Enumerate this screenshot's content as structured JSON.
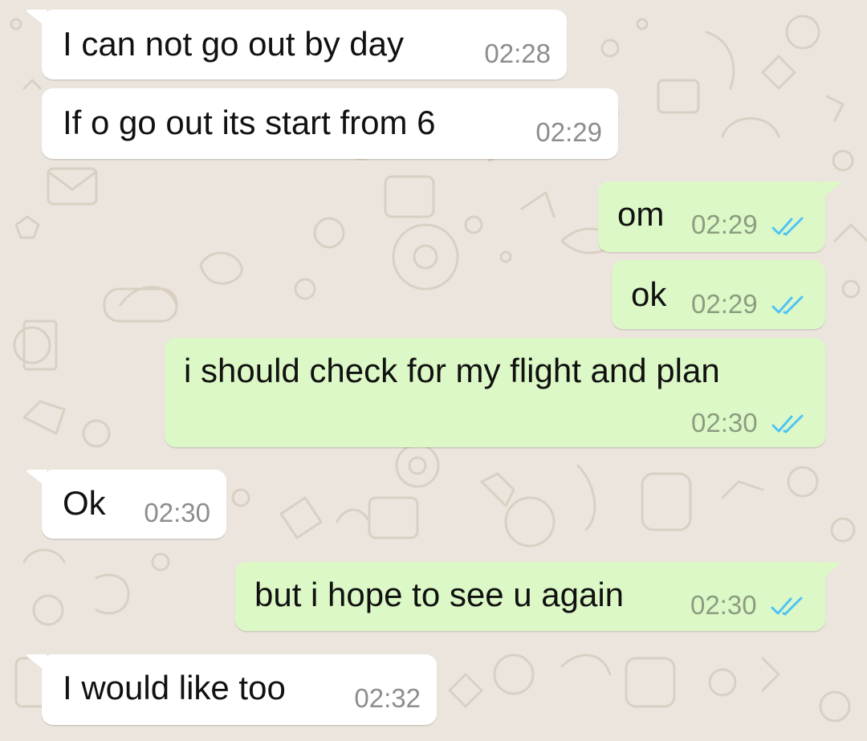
{
  "theme": {
    "incoming_bg": "#ffffff",
    "outgoing_bg": "#dcf8c6",
    "read_ticks_color": "#4fc3f7",
    "wallpaper_bg": "#ece5dd"
  },
  "messages": [
    {
      "dir": "in",
      "text": "I can not go out by day",
      "time": "02:28"
    },
    {
      "dir": "in",
      "text": "If o go out its start from 6",
      "time": "02:29"
    },
    {
      "dir": "out",
      "text": "om",
      "time": "02:29",
      "status": "read"
    },
    {
      "dir": "out",
      "text": "ok",
      "time": "02:29",
      "status": "read"
    },
    {
      "dir": "out",
      "text": "i should check for my flight and plan",
      "time": "02:30",
      "status": "read"
    },
    {
      "dir": "in",
      "text": "Ok",
      "time": "02:30"
    },
    {
      "dir": "out",
      "text": "but i hope to see u again",
      "time": "02:30",
      "status": "read"
    },
    {
      "dir": "in",
      "text": "I would like too",
      "time": "02:32"
    }
  ]
}
